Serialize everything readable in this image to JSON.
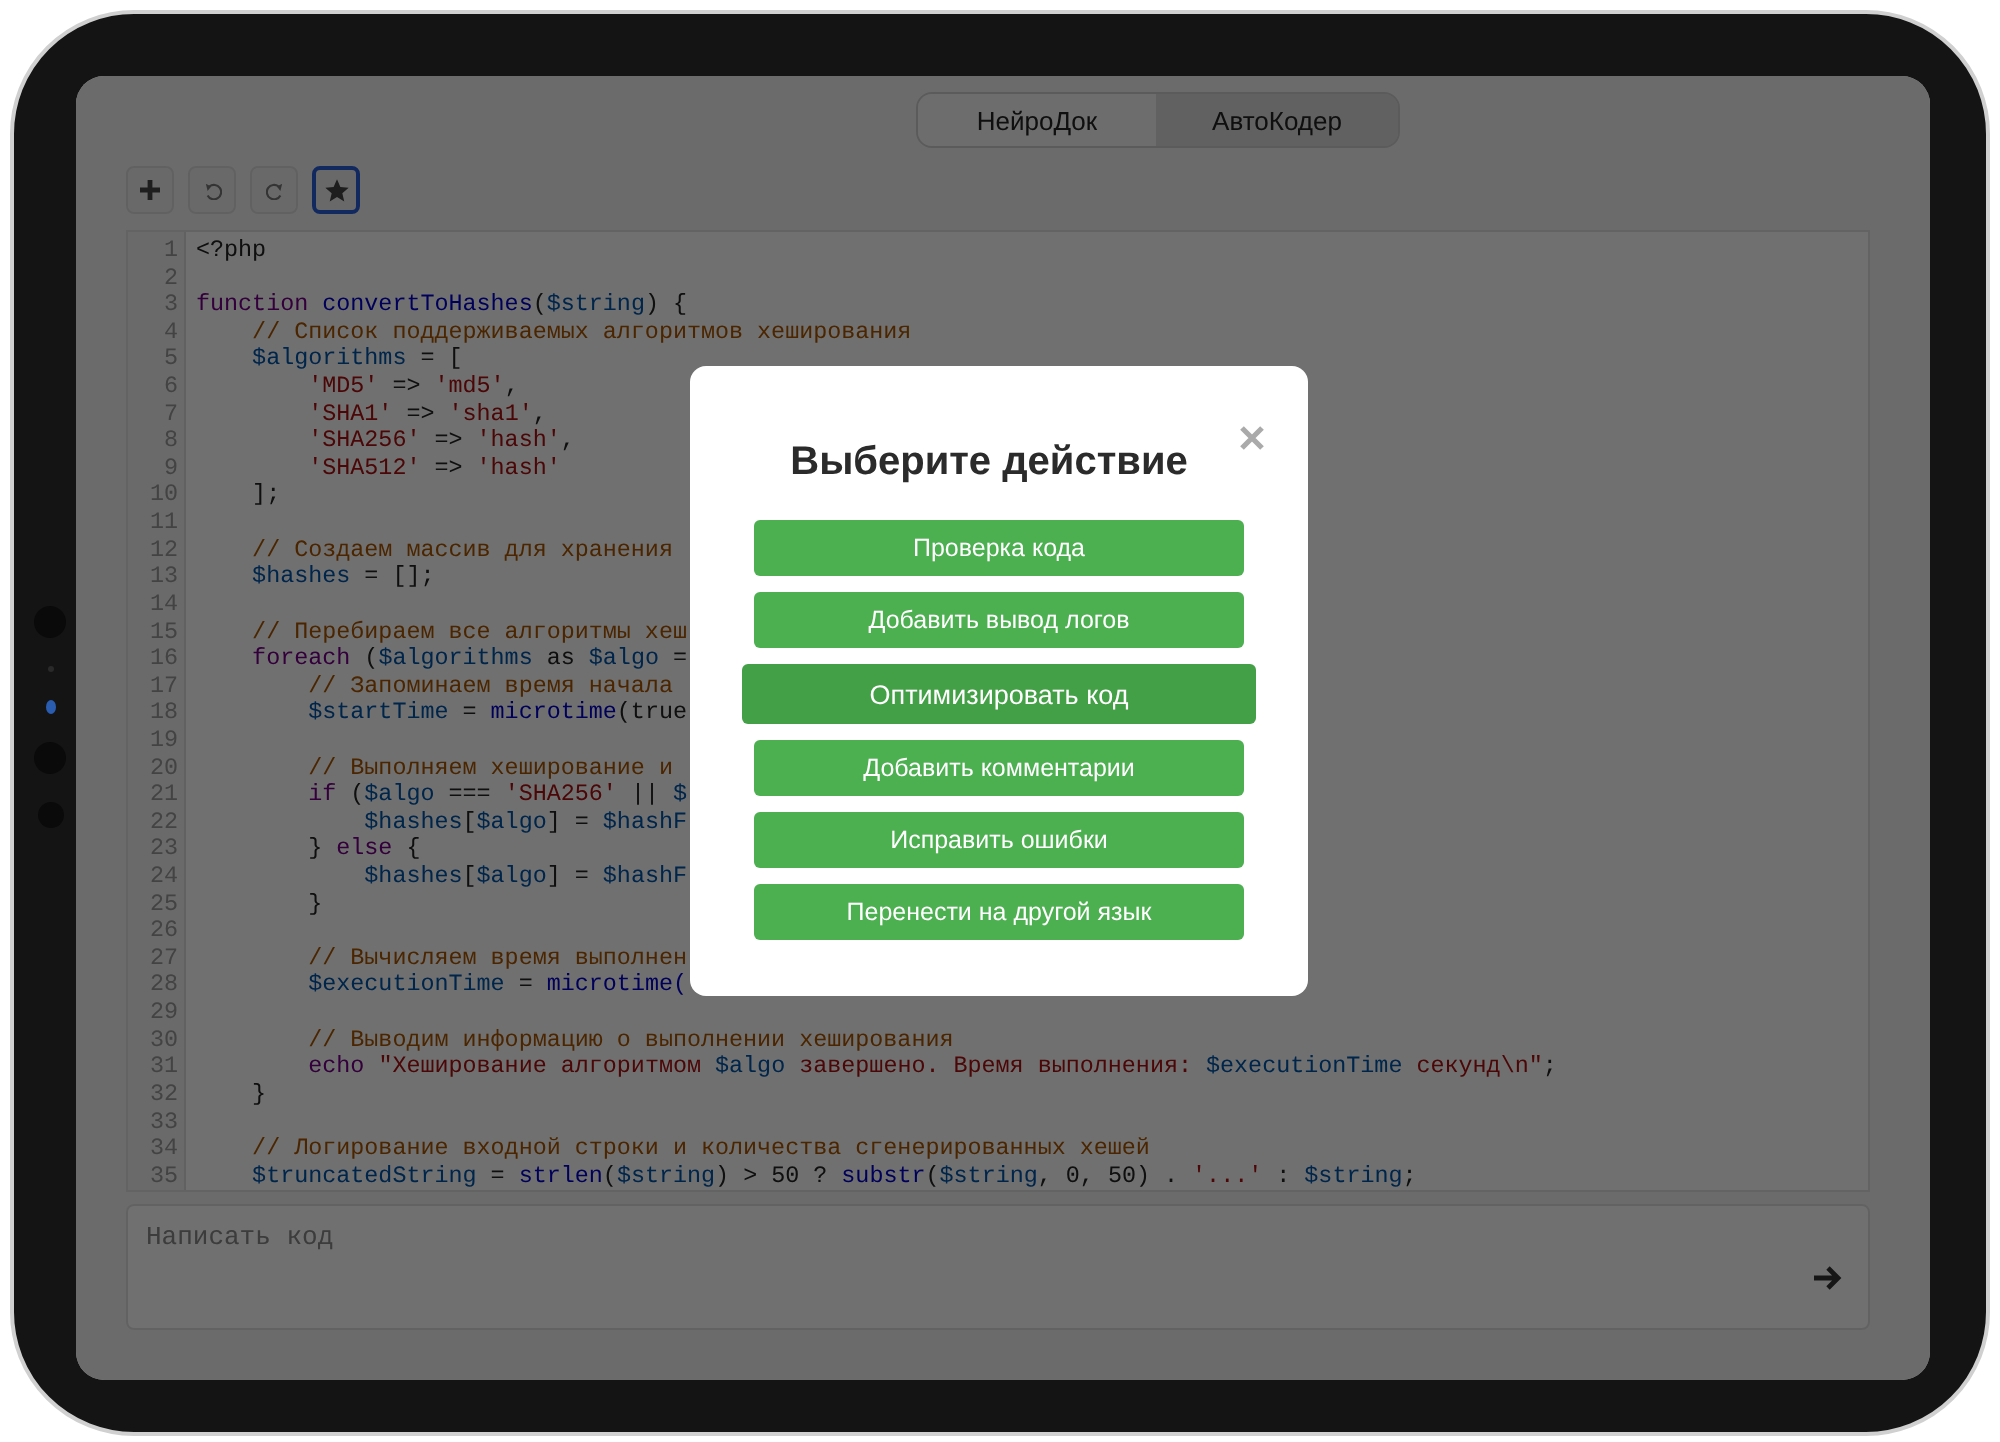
{
  "tabs": [
    {
      "label": "НейроДок",
      "selected": false
    },
    {
      "label": "АвтоКодер",
      "selected": true
    }
  ],
  "toolbar": [
    {
      "kind": "add",
      "active": false
    },
    {
      "kind": "undo",
      "active": false
    },
    {
      "kind": "redo",
      "active": false
    },
    {
      "kind": "star",
      "active": true
    }
  ],
  "editor": {
    "lines": [
      {
        "n": "1",
        "tokens": [
          {
            "kind": "plain",
            "text": "<?php"
          }
        ]
      },
      {
        "n": "2"
      },
      {
        "n": "3",
        "tokens": [
          {
            "kind": "keyword",
            "text": "function "
          },
          {
            "kind": "func",
            "text": "convertToHashes"
          },
          {
            "kind": "plain",
            "text": "("
          },
          {
            "kind": "var",
            "text": "$string"
          },
          {
            "kind": "plain",
            "text": ") {"
          }
        ]
      },
      {
        "n": "4",
        "tokens": [
          {
            "kind": "comment",
            "text": "    // Список поддерживаемых алгоритмов хеширования"
          }
        ]
      },
      {
        "n": "5",
        "tokens": [
          {
            "kind": "var",
            "text": "    $algorithms"
          },
          {
            "kind": "plain",
            "text": " = ["
          }
        ]
      },
      {
        "n": "6",
        "tokens": [
          {
            "kind": "string",
            "text": "        'MD5'"
          },
          {
            "kind": "plain",
            "text": " => "
          },
          {
            "kind": "string",
            "text": "'md5'"
          },
          {
            "kind": "plain",
            "text": ","
          }
        ]
      },
      {
        "n": "7",
        "tokens": [
          {
            "kind": "string",
            "text": "        'SHA1'"
          },
          {
            "kind": "plain",
            "text": " => "
          },
          {
            "kind": "string",
            "text": "'sha1'"
          },
          {
            "kind": "plain",
            "text": ","
          }
        ]
      },
      {
        "n": "8",
        "tokens": [
          {
            "kind": "string",
            "text": "        'SHA256'"
          },
          {
            "kind": "plain",
            "text": " => "
          },
          {
            "kind": "string",
            "text": "'hash'"
          },
          {
            "kind": "plain",
            "text": ","
          }
        ]
      },
      {
        "n": "9",
        "tokens": [
          {
            "kind": "string",
            "text": "        'SHA512'"
          },
          {
            "kind": "plain",
            "text": " => "
          },
          {
            "kind": "string",
            "text": "'hash'"
          }
        ]
      },
      {
        "n": "10",
        "tokens": [
          {
            "kind": "plain",
            "text": "    ];"
          }
        ]
      },
      {
        "n": "11"
      },
      {
        "n": "12",
        "tokens": [
          {
            "kind": "comment",
            "text": "    // Создаем массив для хранения"
          }
        ]
      },
      {
        "n": "13",
        "tokens": [
          {
            "kind": "var",
            "text": "    $hashes"
          },
          {
            "kind": "plain",
            "text": " = [];"
          }
        ]
      },
      {
        "n": "14"
      },
      {
        "n": "15",
        "tokens": [
          {
            "kind": "comment",
            "text": "    // Перебираем все алгоритмы хеш"
          }
        ]
      },
      {
        "n": "16",
        "tokens": [
          {
            "kind": "keyword",
            "text": "    foreach"
          },
          {
            "kind": "plain",
            "text": " ("
          },
          {
            "kind": "var",
            "text": "$algorithms"
          },
          {
            "kind": "plain",
            "text": " as "
          },
          {
            "kind": "var",
            "text": "$algo"
          },
          {
            "kind": "plain",
            "text": " ="
          }
        ]
      },
      {
        "n": "17",
        "tokens": [
          {
            "kind": "comment",
            "text": "        // Запоминаем время начала"
          }
        ]
      },
      {
        "n": "18",
        "tokens": [
          {
            "kind": "var",
            "text": "        $startTime"
          },
          {
            "kind": "plain",
            "text": " = "
          },
          {
            "kind": "func",
            "text": "microtime"
          },
          {
            "kind": "plain",
            "text": "(true"
          }
        ]
      },
      {
        "n": "19"
      },
      {
        "n": "20",
        "tokens": [
          {
            "kind": "comment",
            "text": "        // Выполняем хеширование и"
          }
        ]
      },
      {
        "n": "21",
        "tokens": [
          {
            "kind": "keyword",
            "text": "        if"
          },
          {
            "kind": "plain",
            "text": " ("
          },
          {
            "kind": "var",
            "text": "$algo"
          },
          {
            "kind": "plain",
            "text": " === "
          },
          {
            "kind": "string",
            "text": "'SHA256'"
          },
          {
            "kind": "plain",
            "text": " || "
          },
          {
            "kind": "var",
            "text": "$"
          }
        ]
      },
      {
        "n": "22",
        "tokens": [
          {
            "kind": "var",
            "text": "            $hashes"
          },
          {
            "kind": "plain",
            "text": "["
          },
          {
            "kind": "var",
            "text": "$algo"
          },
          {
            "kind": "plain",
            "text": "] = "
          },
          {
            "kind": "var",
            "text": "$hashF"
          }
        ]
      },
      {
        "n": "23",
        "tokens": [
          {
            "kind": "plain",
            "text": "        } "
          },
          {
            "kind": "keyword",
            "text": "else"
          },
          {
            "kind": "plain",
            "text": " {"
          }
        ]
      },
      {
        "n": "24",
        "tokens": [
          {
            "kind": "var",
            "text": "            $hashes"
          },
          {
            "kind": "plain",
            "text": "["
          },
          {
            "kind": "var",
            "text": "$algo"
          },
          {
            "kind": "plain",
            "text": "] = "
          },
          {
            "kind": "var",
            "text": "$hashF"
          }
        ]
      },
      {
        "n": "25",
        "tokens": [
          {
            "kind": "plain",
            "text": "        }"
          }
        ]
      },
      {
        "n": "26"
      },
      {
        "n": "27",
        "tokens": [
          {
            "kind": "comment",
            "text": "        // Вычисляем время выполнен"
          }
        ]
      },
      {
        "n": "28",
        "tokens": [
          {
            "kind": "var",
            "text": "        $executionTime"
          },
          {
            "kind": "plain",
            "text": " = "
          },
          {
            "kind": "func",
            "text": "microtime("
          }
        ]
      },
      {
        "n": "29"
      },
      {
        "n": "30",
        "tokens": [
          {
            "kind": "comment",
            "text": "        // Выводим информацию о выполнении хеширования"
          }
        ]
      },
      {
        "n": "31",
        "tokens": [
          {
            "kind": "keyword",
            "text": "        echo "
          },
          {
            "kind": "string",
            "text": "\"Хеширование алгоритмом "
          },
          {
            "kind": "var",
            "text": "$algo"
          },
          {
            "kind": "string",
            "text": " завершено. Время выполнения: "
          },
          {
            "kind": "var",
            "text": "$executionTime"
          },
          {
            "kind": "string",
            "text": " секунд\\n\""
          },
          {
            "kind": "plain",
            "text": ";"
          }
        ]
      },
      {
        "n": "32",
        "tokens": [
          {
            "kind": "plain",
            "text": "    }"
          }
        ]
      },
      {
        "n": "33"
      },
      {
        "n": "34",
        "tokens": [
          {
            "kind": "comment",
            "text": "    // Логирование входной строки и количества сгенерированных хешей"
          }
        ]
      },
      {
        "n": "35",
        "tokens": [
          {
            "kind": "var",
            "text": "    $truncatedString"
          },
          {
            "kind": "plain",
            "text": " = "
          },
          {
            "kind": "func",
            "text": "strlen"
          },
          {
            "kind": "plain",
            "text": "("
          },
          {
            "kind": "var",
            "text": "$string"
          },
          {
            "kind": "plain",
            "text": ") > 50 ? "
          },
          {
            "kind": "func",
            "text": "substr"
          },
          {
            "kind": "plain",
            "text": "("
          },
          {
            "kind": "var",
            "text": "$string"
          },
          {
            "kind": "plain",
            "text": ", 0, 50) . "
          },
          {
            "kind": "string",
            "text": "'...'"
          },
          {
            "kind": "plain",
            "text": " : "
          },
          {
            "kind": "var",
            "text": "$string"
          },
          {
            "kind": "plain",
            "text": ";"
          }
        ]
      }
    ]
  },
  "prompt": {
    "placeholder": "Написать код"
  },
  "modal": {
    "title": "Выберите действие",
    "actions": [
      {
        "label": "Проверка кода",
        "hovered": false
      },
      {
        "label": "Добавить вывод логов",
        "hovered": false
      },
      {
        "label": "Оптимизировать код",
        "hovered": true
      },
      {
        "label": "Добавить комментарии",
        "hovered": false
      },
      {
        "label": "Исправить ошибки",
        "hovered": false
      },
      {
        "label": "Перенести на другой язык",
        "hovered": false
      }
    ]
  }
}
